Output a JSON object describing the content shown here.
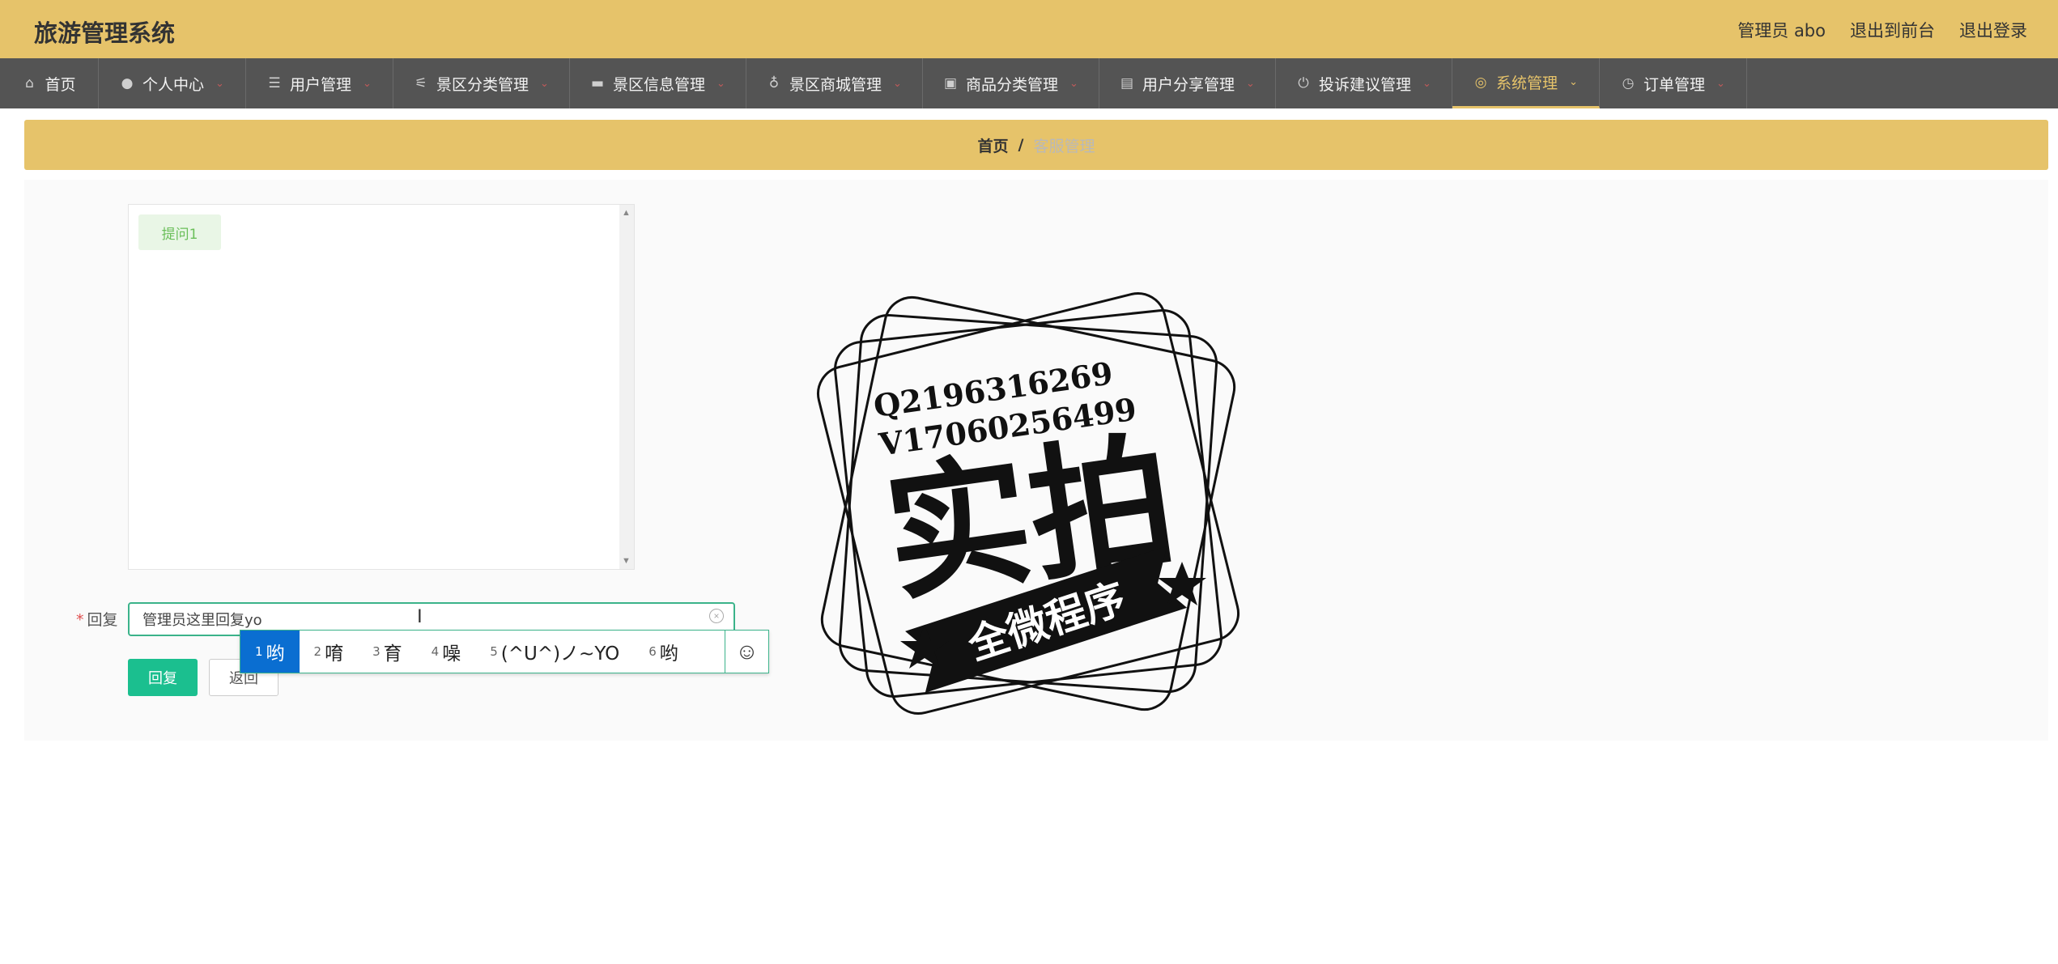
{
  "header": {
    "brand": "旅游管理系统",
    "admin": "管理员 abo",
    "to_front": "退出到前台",
    "logout": "退出登录"
  },
  "nav": [
    {
      "label": "首页",
      "icon": "home-icon"
    },
    {
      "label": "个人中心",
      "icon": "user-icon"
    },
    {
      "label": "用户管理",
      "icon": "list-icon"
    },
    {
      "label": "景区分类管理",
      "icon": "sliders-icon"
    },
    {
      "label": "景区信息管理",
      "icon": "folder-icon"
    },
    {
      "label": "景区商城管理",
      "icon": "mic-icon"
    },
    {
      "label": "商品分类管理",
      "icon": "clipboard-icon"
    },
    {
      "label": "用户分享管理",
      "icon": "briefcase-icon"
    },
    {
      "label": "投诉建议管理",
      "icon": "power-icon"
    },
    {
      "label": "系统管理",
      "icon": "compass-icon",
      "active": true
    },
    {
      "label": "订单管理",
      "icon": "clock-icon"
    }
  ],
  "breadcrumb": {
    "home": "首页",
    "separator": "/",
    "current": "客服管理"
  },
  "chat": {
    "messages": [
      {
        "text": "提问1"
      }
    ]
  },
  "form": {
    "required_mark": "*",
    "reply_label": "回复",
    "reply_value": "管理员这里回复yo",
    "reply_button": "回复",
    "back_button": "返回"
  },
  "ime": {
    "candidates": [
      {
        "n": "1",
        "text": "哟",
        "selected": true
      },
      {
        "n": "2",
        "text": "唷"
      },
      {
        "n": "3",
        "text": "育"
      },
      {
        "n": "4",
        "text": "噪"
      },
      {
        "n": "5",
        "text": "(^U^)ノ~YO"
      },
      {
        "n": "6",
        "text": "哟"
      }
    ]
  },
  "watermark": {
    "line1": "Q2196316269",
    "line2": "V17060256499",
    "big": "实拍",
    "ribbon": "全微程序"
  },
  "colors": {
    "accent": "#e6c36a",
    "nav_bg": "#545454",
    "primary_button": "#1bbf8f",
    "ime_selected": "#0a6ed1"
  }
}
